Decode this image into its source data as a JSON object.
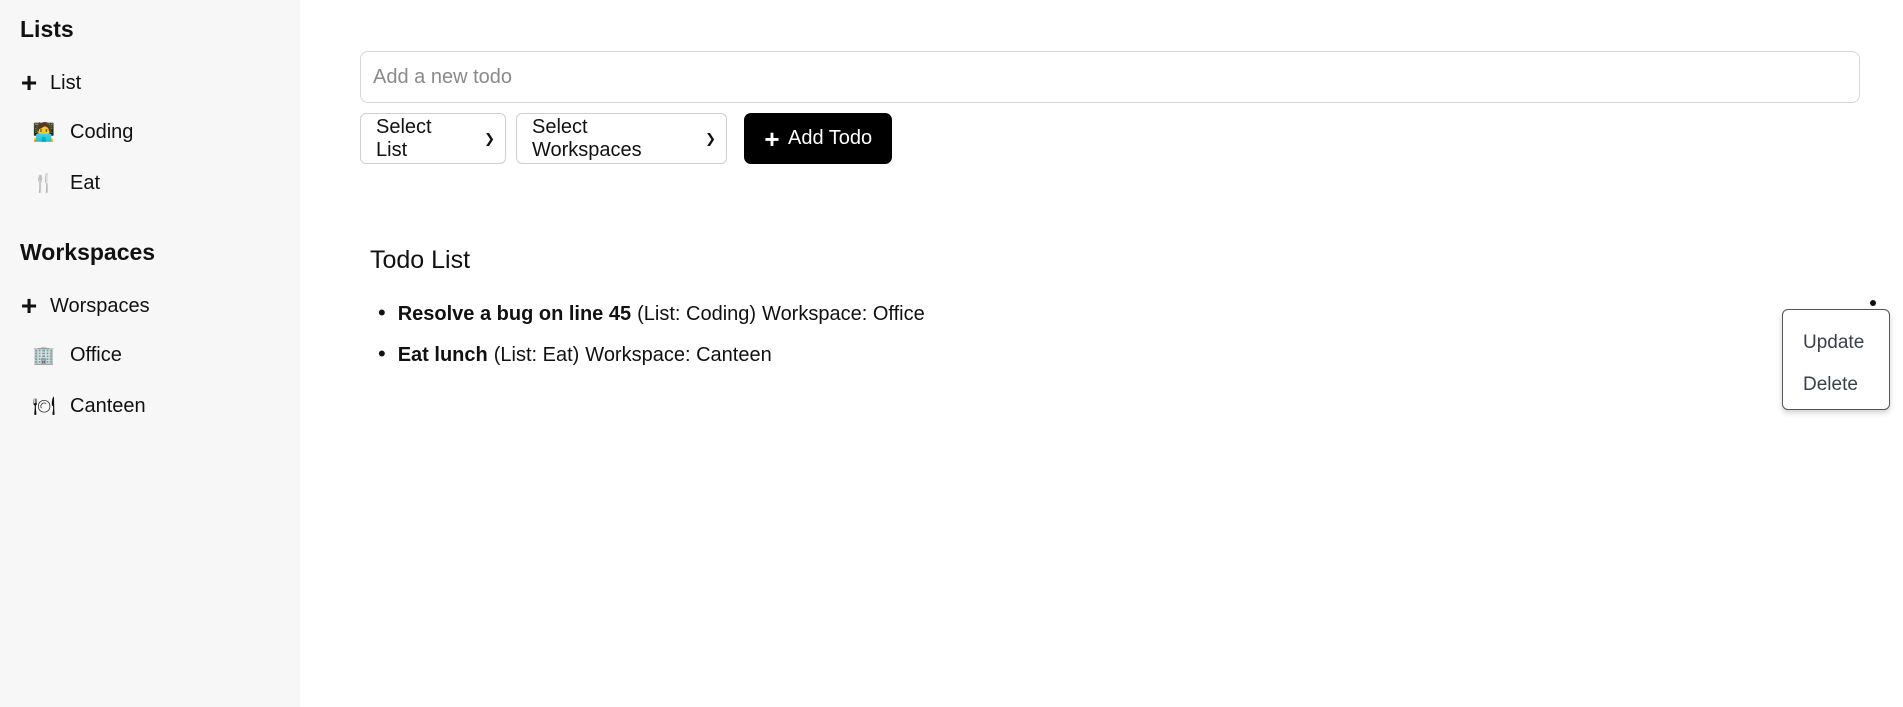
{
  "sidebar": {
    "lists_title": "Lists",
    "add_list_label": "List",
    "lists": [
      {
        "icon": "person-at-desk-icon",
        "glyph": "🧑‍💻",
        "label": "Coding"
      },
      {
        "icon": "fork-and-knife-icon",
        "glyph": "🍴",
        "label": "Eat"
      }
    ],
    "workspaces_title": "Workspaces",
    "add_workspace_label": "Worspaces",
    "workspaces": [
      {
        "icon": "office-building-icon",
        "glyph": "🏢",
        "label": "Office"
      },
      {
        "icon": "plate-with-cutlery-icon",
        "glyph": "🍽",
        "label": "Canteen"
      }
    ]
  },
  "form": {
    "placeholder": "Add a new todo",
    "select_list": "Select List",
    "select_workspaces": "Select Workspaces",
    "add_button": "Add Todo"
  },
  "todo_list": {
    "title": "Todo List",
    "items": [
      {
        "name": "Resolve a bug on line 45",
        "list": "(List: Coding)",
        "workspace": "Workspace: Office"
      },
      {
        "name": "Eat lunch",
        "list": "(List: Eat)",
        "workspace": "Workspace: Canteen"
      }
    ]
  },
  "menu": {
    "update": "Update",
    "delete": "Delete"
  }
}
